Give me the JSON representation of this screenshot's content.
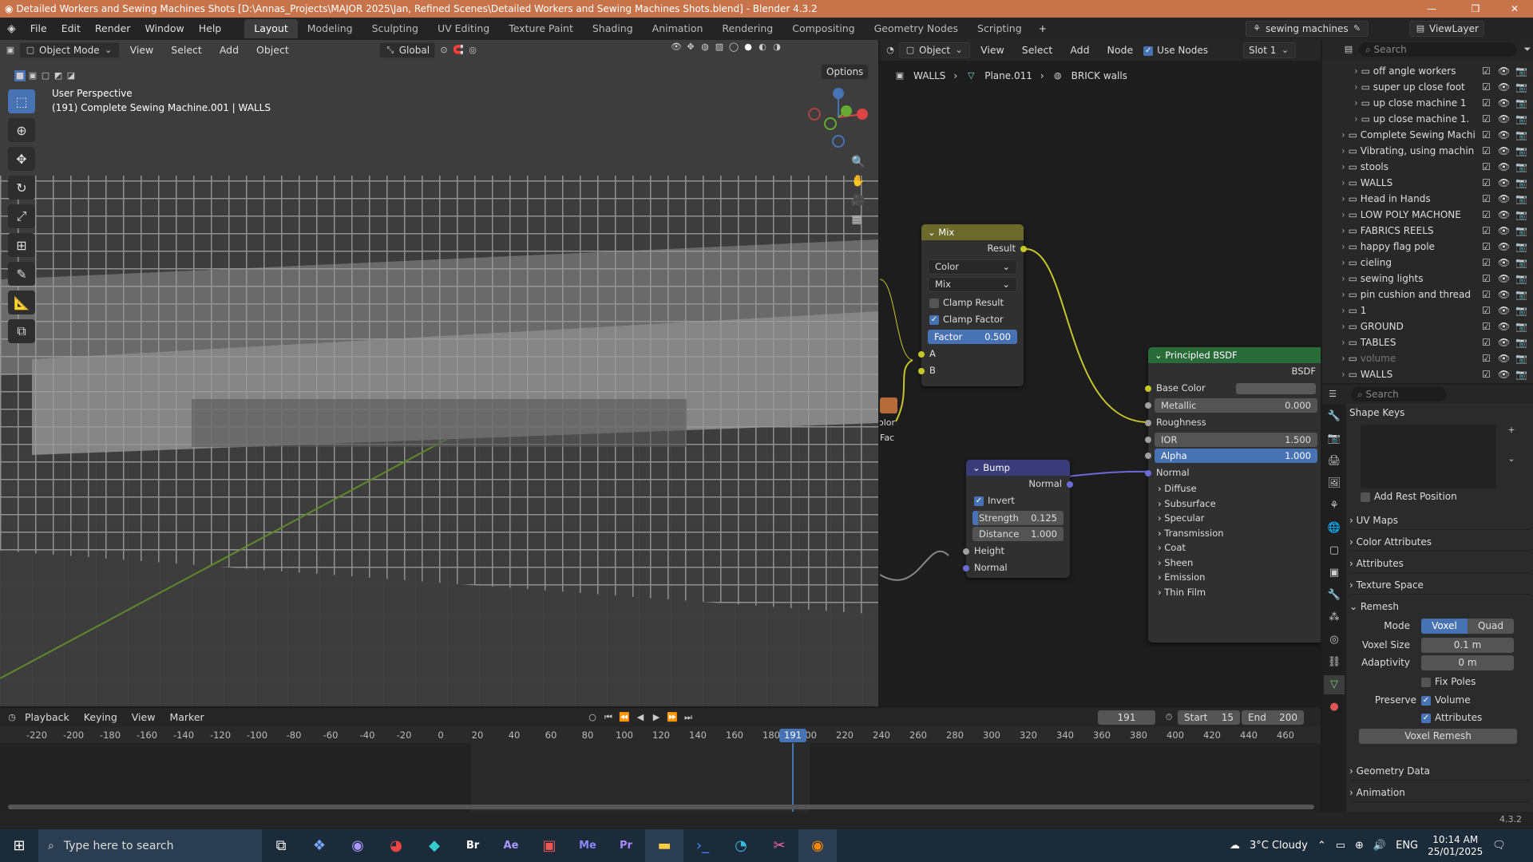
{
  "titlebar": {
    "title": "Detailed Workers and Sewing Machines Shots [D:\\Annas_Projects\\MAJOR 2025\\Jan, Refined Scenes\\Detailed Workers and Sewing Machines Shots.blend] - Blender 4.3.2"
  },
  "menu": [
    "File",
    "Edit",
    "Render",
    "Window",
    "Help"
  ],
  "workspaces": [
    "Layout",
    "Modeling",
    "Sculpting",
    "UV Editing",
    "Texture Paint",
    "Shading",
    "Animation",
    "Rendering",
    "Compositing",
    "Geometry Nodes",
    "Scripting"
  ],
  "scene_name": "sewing machines",
  "view_layer": "ViewLayer",
  "viewport": {
    "mode": "Object Mode",
    "menus": [
      "View",
      "Select",
      "Add",
      "Object"
    ],
    "orientation": "Global",
    "options_label": "Options",
    "perspective_label": "User Perspective",
    "object_label": "(191) Complete Sewing Machine.001 | WALLS"
  },
  "node_editor": {
    "type": "Object",
    "menus": [
      "View",
      "Select",
      "Add",
      "Node"
    ],
    "use_nodes_label": "Use Nodes",
    "slot": "Slot 1",
    "breadcrumb": [
      "WALLS",
      "Plane.011",
      "BRICK walls"
    ],
    "mix_node": {
      "title": "Mix",
      "output": "Result",
      "data_type": "Color",
      "blend": "Mix",
      "clamp_result": "Clamp Result",
      "clamp_factor": "Clamp Factor",
      "factor_label": "Factor",
      "factor_value": "0.500",
      "inputs": [
        "A",
        "B"
      ]
    },
    "bump_node": {
      "title": "Bump",
      "output": "Normal",
      "invert": "Invert",
      "strength_label": "Strength",
      "strength_value": "0.125",
      "distance_label": "Distance",
      "distance_value": "1.000",
      "inputs": [
        "Height",
        "Normal"
      ]
    },
    "bsdf_node": {
      "title": "Principled BSDF",
      "output": "BSDF",
      "base_color": "Base Color",
      "metallic_label": "Metallic",
      "metallic_value": "0.000",
      "roughness": "Roughness",
      "ior_label": "IOR",
      "ior_value": "1.500",
      "alpha_label": "Alpha",
      "alpha_value": "1.000",
      "normal": "Normal",
      "panels": [
        "Diffuse",
        "Subsurface",
        "Specular",
        "Transmission",
        "Coat",
        "Sheen",
        "Emission",
        "Thin Film"
      ]
    },
    "partial_labels": [
      "olor",
      "Fac"
    ]
  },
  "outliner": {
    "search_placeholder": "Search",
    "items": [
      {
        "label": "off angle workers",
        "indent": 2
      },
      {
        "label": "super up close foot",
        "indent": 2
      },
      {
        "label": "up close machine 1",
        "indent": 2
      },
      {
        "label": "up close machine 1.",
        "indent": 2
      },
      {
        "label": "Complete Sewing Machi",
        "indent": 1
      },
      {
        "label": "Vibrating, using machin",
        "indent": 1
      },
      {
        "label": "stools",
        "indent": 1
      },
      {
        "label": "WALLS",
        "indent": 1
      },
      {
        "label": "Head in Hands",
        "indent": 1
      },
      {
        "label": "LOW POLY MACHONE",
        "indent": 1
      },
      {
        "label": "FABRICS REELS",
        "indent": 1
      },
      {
        "label": "happy flag pole",
        "indent": 1
      },
      {
        "label": "cieling",
        "indent": 1
      },
      {
        "label": "sewing lights",
        "indent": 1
      },
      {
        "label": "pin cushion and thread",
        "indent": 1
      },
      {
        "label": "1",
        "indent": 1
      },
      {
        "label": "GROUND",
        "indent": 1
      },
      {
        "label": "TABLES",
        "indent": 1
      },
      {
        "label": "volume",
        "indent": 1
      },
      {
        "label": "WALLS",
        "indent": 1
      }
    ]
  },
  "properties": {
    "search_placeholder": "Search",
    "shape_keys": "Shape Keys",
    "add_rest_position": "Add Rest Position",
    "sections": [
      "UV Maps",
      "Color Attributes",
      "Attributes",
      "Texture Space"
    ],
    "remesh": {
      "title": "Remesh",
      "mode_label": "Mode",
      "mode_voxel": "Voxel",
      "mode_quad": "Quad",
      "voxel_size_label": "Voxel Size",
      "voxel_size_value": "0.1 m",
      "adaptivity_label": "Adaptivity",
      "adaptivity_value": "0 m",
      "fix_poles": "Fix Poles",
      "preserve_label": "Preserve",
      "volume": "Volume",
      "attributes": "Attributes",
      "button": "Voxel Remesh"
    },
    "after_sections": [
      "Geometry Data",
      "Animation"
    ]
  },
  "timeline": {
    "menus": [
      "Playback",
      "Keying",
      "View",
      "Marker"
    ],
    "current_frame": "191",
    "start_label": "Start",
    "start_value": "15",
    "end_label": "End",
    "end_value": "200",
    "ticks": [
      "-220",
      "-200",
      "-180",
      "-160",
      "-140",
      "-120",
      "-100",
      "-80",
      "-60",
      "-40",
      "-20",
      "0",
      "20",
      "40",
      "60",
      "80",
      "100",
      "120",
      "140",
      "160",
      "180",
      "200",
      "220",
      "240",
      "260",
      "280",
      "300",
      "320",
      "340",
      "360",
      "380",
      "400",
      "420",
      "440",
      "460"
    ]
  },
  "statusbar": {
    "version": "4.3.2"
  },
  "taskbar": {
    "search_placeholder": "Type here to search",
    "weather": "3°C  Cloudy",
    "lang": "ENG",
    "time": "10:14 AM",
    "date": "25/01/2025",
    "apps": [
      "task-view",
      "copilot",
      "vpn",
      "chrome",
      "photoshop-alt",
      "bridge",
      "after-effects",
      "premiere-te",
      "media-encoder",
      "premiere",
      "file-explorer",
      "powershell",
      "edge",
      "snipping",
      "blender"
    ]
  }
}
